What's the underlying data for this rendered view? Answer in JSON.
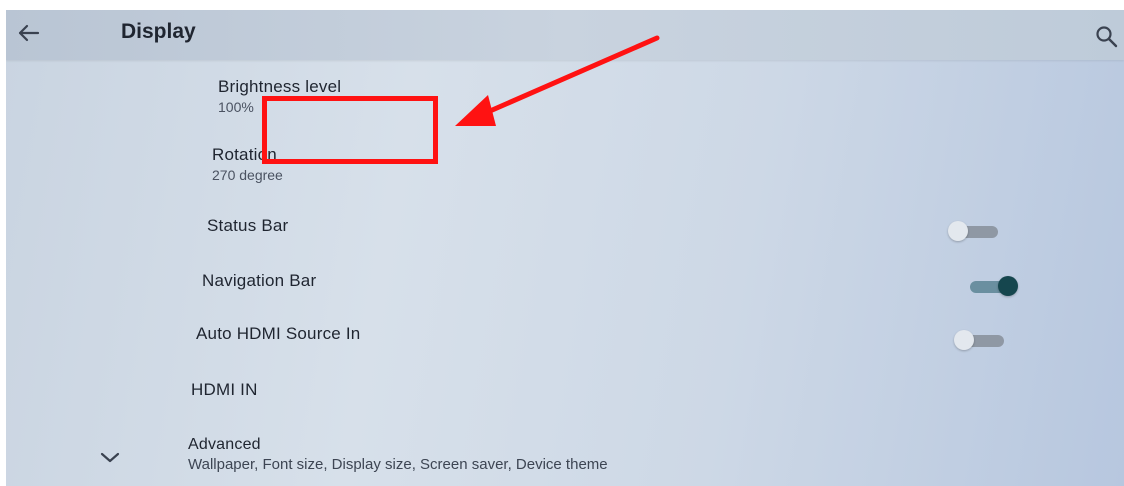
{
  "header": {
    "title": "Display",
    "back_icon": "arrow-left-icon",
    "search_icon": "search-icon"
  },
  "settings": {
    "brightness": {
      "label": "Brightness level",
      "value": "100%"
    },
    "rotation": {
      "label": "Rotation",
      "value": "270 degree"
    },
    "status_bar": {
      "label": "Status Bar",
      "enabled": false
    },
    "navigation_bar": {
      "label": "Navigation Bar",
      "enabled": true
    },
    "auto_hdmi": {
      "label": "Auto HDMI Source In",
      "enabled": false
    },
    "hdmi_in": {
      "label": "HDMI IN"
    },
    "advanced": {
      "label": "Advanced",
      "summary": "Wallpaper, Font size, Display size, Screen saver, Device theme",
      "icon": "chevron-down-icon"
    }
  },
  "annotation": {
    "color": "#ff1212"
  }
}
